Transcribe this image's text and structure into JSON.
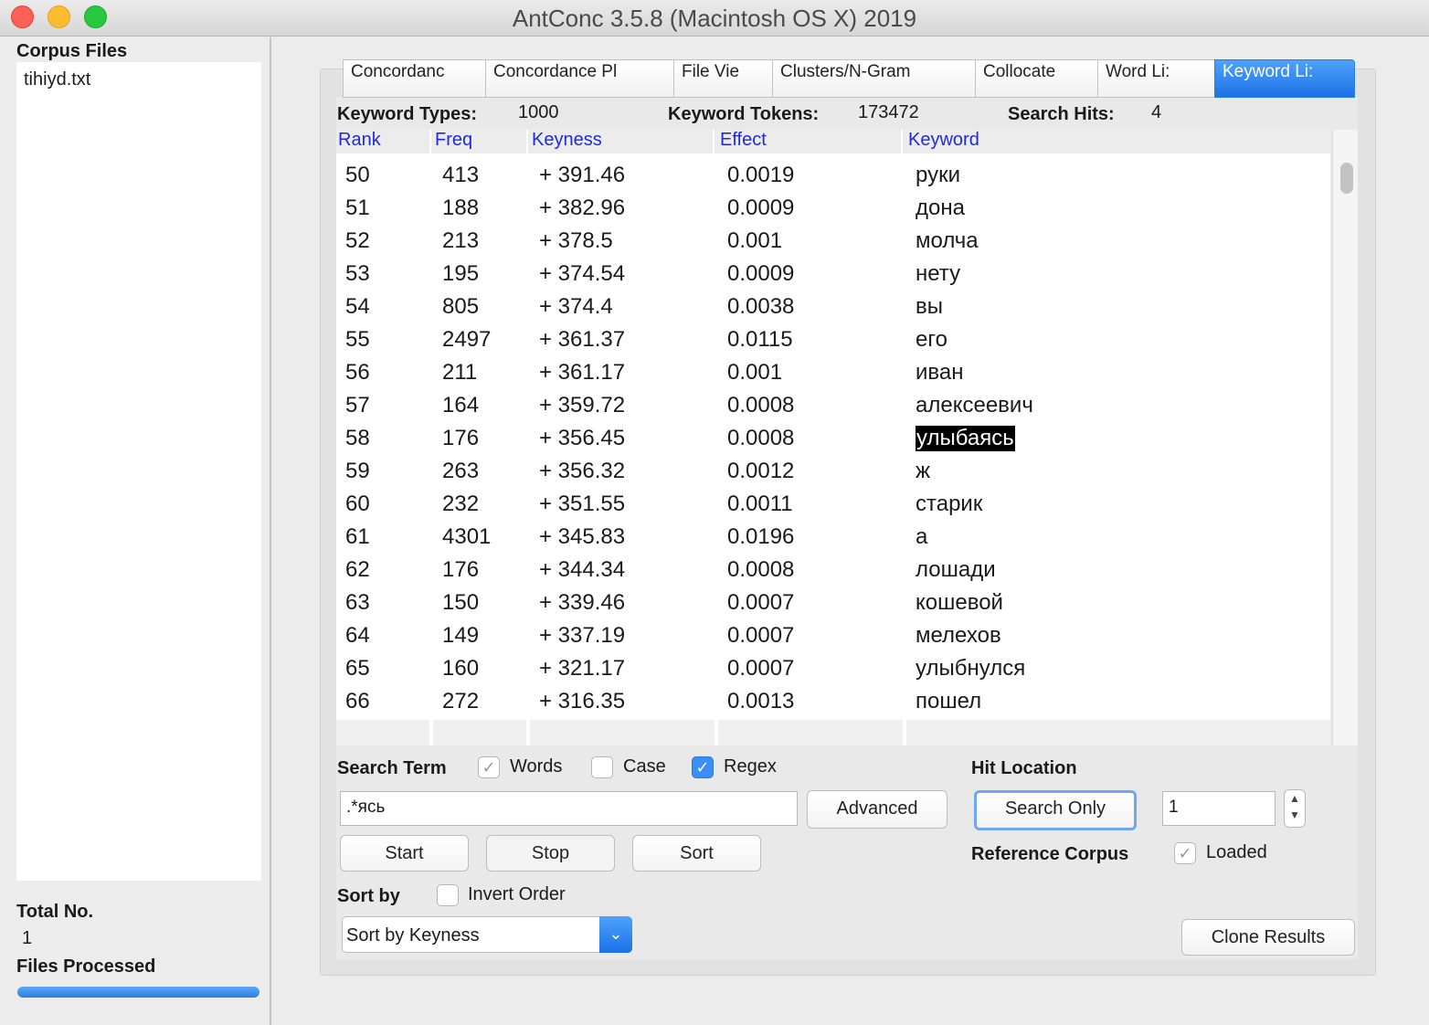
{
  "window": {
    "title": "AntConc 3.5.8 (Macintosh OS X) 2019"
  },
  "left_panel": {
    "corpus_files_label": "Corpus Files",
    "files": [
      "tihiyd.txt"
    ],
    "total_label": "Total No.",
    "total_value": "1",
    "processed_label": "Files Processed",
    "progress": 1.0
  },
  "tabs": [
    "Concordanc",
    "Concordance Pl",
    "File Vie",
    "Clusters/N-Gram",
    "Collocate",
    "Word Li:",
    "Keyword Li:"
  ],
  "active_tab": 6,
  "stats": {
    "types_label": "Keyword Types:",
    "types_value": "1000",
    "tokens_label": "Keyword Tokens:",
    "tokens_value": "173472",
    "hits_label": "Search Hits:",
    "hits_value": "4"
  },
  "table": {
    "columns": [
      "Rank",
      "Freq",
      "Keyness",
      "Effect",
      "Keyword"
    ],
    "rows": [
      [
        "50",
        "413",
        "+ 391.46",
        "0.0019",
        "руки"
      ],
      [
        "51",
        "188",
        "+ 382.96",
        "0.0009",
        "дона"
      ],
      [
        "52",
        "213",
        "+ 378.5",
        "0.001",
        "молча"
      ],
      [
        "53",
        "195",
        "+ 374.54",
        "0.0009",
        "нету"
      ],
      [
        "54",
        "805",
        "+ 374.4",
        "0.0038",
        "вы"
      ],
      [
        "55",
        "2497",
        "+ 361.37",
        "0.0115",
        "его"
      ],
      [
        "56",
        "211",
        "+ 361.17",
        "0.001",
        "иван"
      ],
      [
        "57",
        "164",
        "+ 359.72",
        "0.0008",
        "алексеевич"
      ],
      [
        "58",
        "176",
        "+ 356.45",
        "0.0008",
        "улыбаясь"
      ],
      [
        "59",
        "263",
        "+ 356.32",
        "0.0012",
        "ж"
      ],
      [
        "60",
        "232",
        "+ 351.55",
        "0.0011",
        "старик"
      ],
      [
        "61",
        "4301",
        "+ 345.83",
        "0.0196",
        "а"
      ],
      [
        "62",
        "176",
        "+ 344.34",
        "0.0008",
        "лошади"
      ],
      [
        "63",
        "150",
        "+ 339.46",
        "0.0007",
        "кошевой"
      ],
      [
        "64",
        "149",
        "+ 337.19",
        "0.0007",
        "мелехов"
      ],
      [
        "65",
        "160",
        "+ 321.17",
        "0.0007",
        "улыбнулся"
      ],
      [
        "66",
        "272",
        "+ 316.35",
        "0.0013",
        "пошел"
      ]
    ],
    "selected_row": 8
  },
  "search": {
    "term_label": "Search Term",
    "words_label": "Words",
    "words_checked": true,
    "case_label": "Case",
    "case_checked": false,
    "regex_label": "Regex",
    "regex_checked": true,
    "value": ".*ясь",
    "advanced_label": "Advanced",
    "start_label": "Start",
    "stop_label": "Stop",
    "sort_label": "Sort"
  },
  "hit_location": {
    "label": "Hit Location",
    "search_only_label": "Search Only",
    "value": "1"
  },
  "reference_corpus": {
    "label": "Reference Corpus",
    "loaded_label": "Loaded",
    "loaded_checked": true
  },
  "sort": {
    "label": "Sort by",
    "invert_label": "Invert Order",
    "invert_checked": false,
    "selected": "Sort by Keyness"
  },
  "clone_label": "Clone Results",
  "icons": {
    "check": "✓",
    "dropdown": "chevron-down-icon",
    "stepper": "stepper-icon"
  }
}
